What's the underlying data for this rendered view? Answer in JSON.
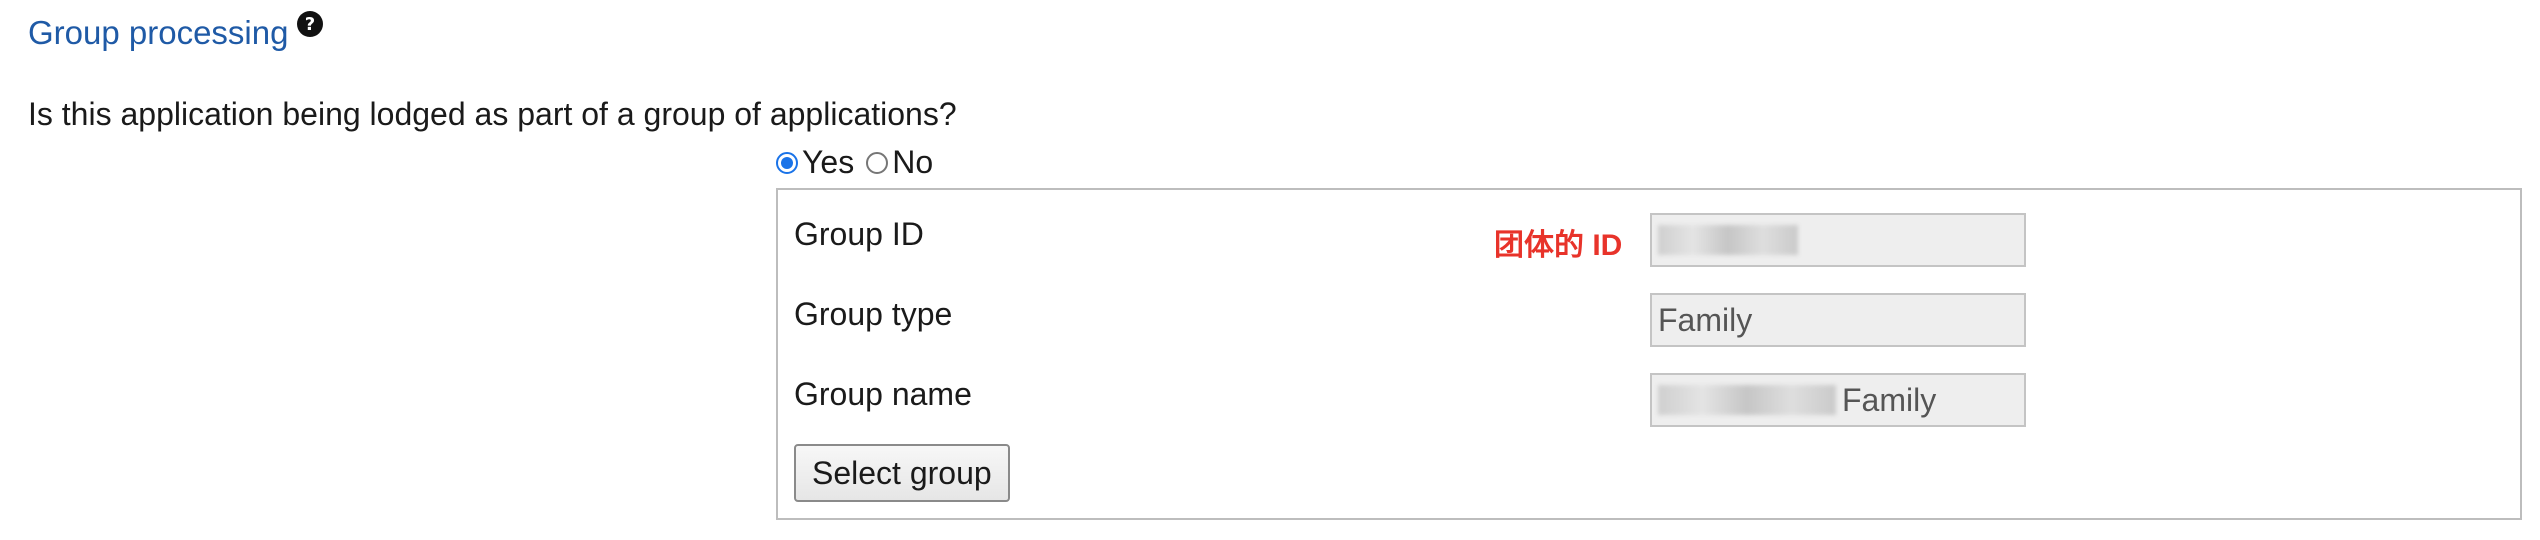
{
  "section": {
    "title": "Group processing",
    "help_icon": "question-circle-icon"
  },
  "question": {
    "text": "Is this application being lodged as part of a group of applications?"
  },
  "radio": {
    "yes_label": "Yes",
    "no_label": "No",
    "selected": "Yes"
  },
  "group": {
    "fields": [
      {
        "label": "Group ID",
        "value": "",
        "annotation": "团体的 ID"
      },
      {
        "label": "Group type",
        "value": "Family"
      },
      {
        "label": "Group name",
        "value": "Family"
      }
    ],
    "select_button_label": "Select group"
  },
  "colors": {
    "title": "#1f5aa6",
    "annotation": "#e8332a",
    "radio_checked": "#1a73e8"
  }
}
